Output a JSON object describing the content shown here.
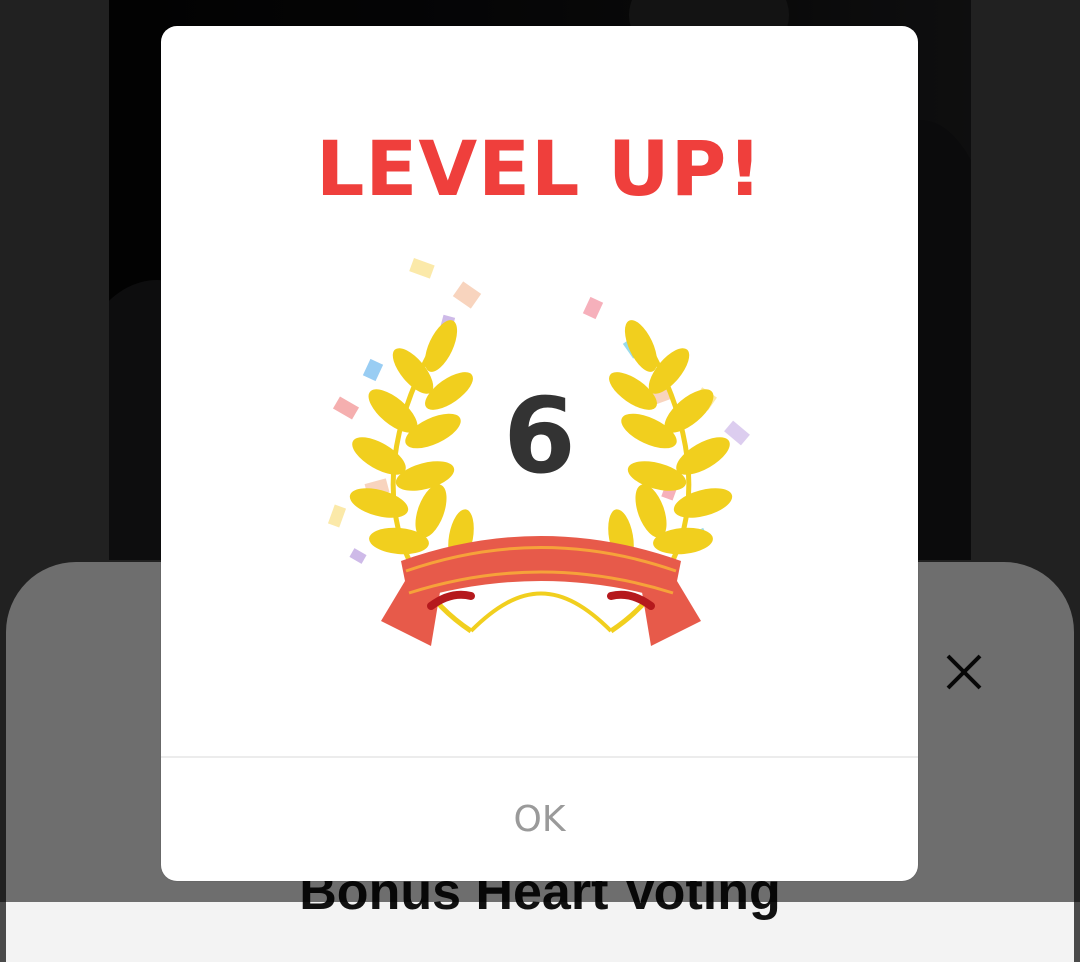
{
  "background": {
    "sheet_title": "Bonus Heart Voting",
    "close_icon": "close-icon"
  },
  "modal": {
    "title": "LEVEL UP!",
    "level": "6",
    "ok_label": "OK",
    "emblem_icon": "laurel-wreath-icon"
  },
  "colors": {
    "title_red": "#ef3f3c",
    "ribbon_red": "#e75a4a",
    "laurel_gold": "#f1cf1e",
    "number_dark": "#333333",
    "ok_gray": "#9a9a9a"
  }
}
